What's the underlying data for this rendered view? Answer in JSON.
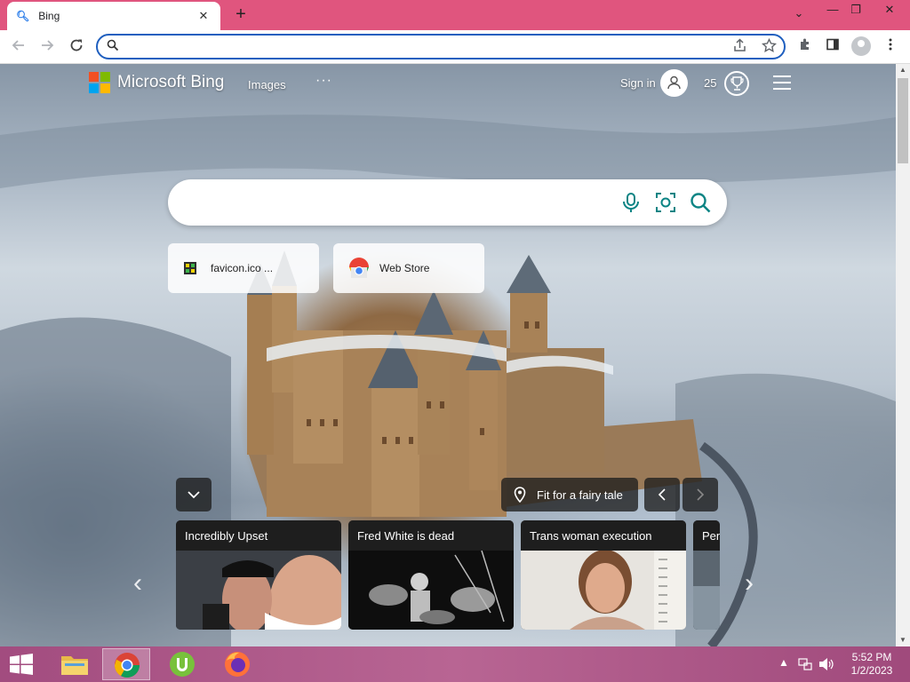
{
  "browser": {
    "tab": {
      "title": "Bing",
      "close": "✕"
    },
    "new_tab": "+",
    "window_controls": {
      "minimize": "⌄",
      "restore": "—",
      "maximize": "❐",
      "close": "✕"
    },
    "address": {
      "value": "",
      "placeholder": ""
    }
  },
  "bing": {
    "brand": "Microsoft Bing",
    "nav_images": "Images",
    "nav_more": "···",
    "sign_in": "Sign in",
    "points": "25",
    "search": {
      "value": "",
      "placeholder": ""
    },
    "quick_links": [
      {
        "label": "favicon.ico ...",
        "icon": "favicon-icon"
      },
      {
        "label": "Web Store",
        "icon": "chrome-web-store-icon"
      }
    ],
    "image_caption": "Fit for a fairy tale",
    "prev_label": "‹",
    "next_label": "›",
    "collapse_label": "⌄",
    "news": [
      {
        "title": "Incredibly Upset"
      },
      {
        "title": "Fred White is dead"
      },
      {
        "title": "Trans woman execution"
      },
      {
        "title": "Pen"
      }
    ]
  },
  "taskbar": {
    "apps": [
      "file-explorer-icon",
      "chrome-icon",
      "utorrent-icon",
      "firefox-icon"
    ],
    "time": "5:52 PM",
    "date": "1/2/2023"
  },
  "colors": {
    "titlebar": "#e0557e",
    "omnibox_border": "#1f5fbf",
    "bing_accent": "#0c8484",
    "taskbar": "#b86593"
  }
}
